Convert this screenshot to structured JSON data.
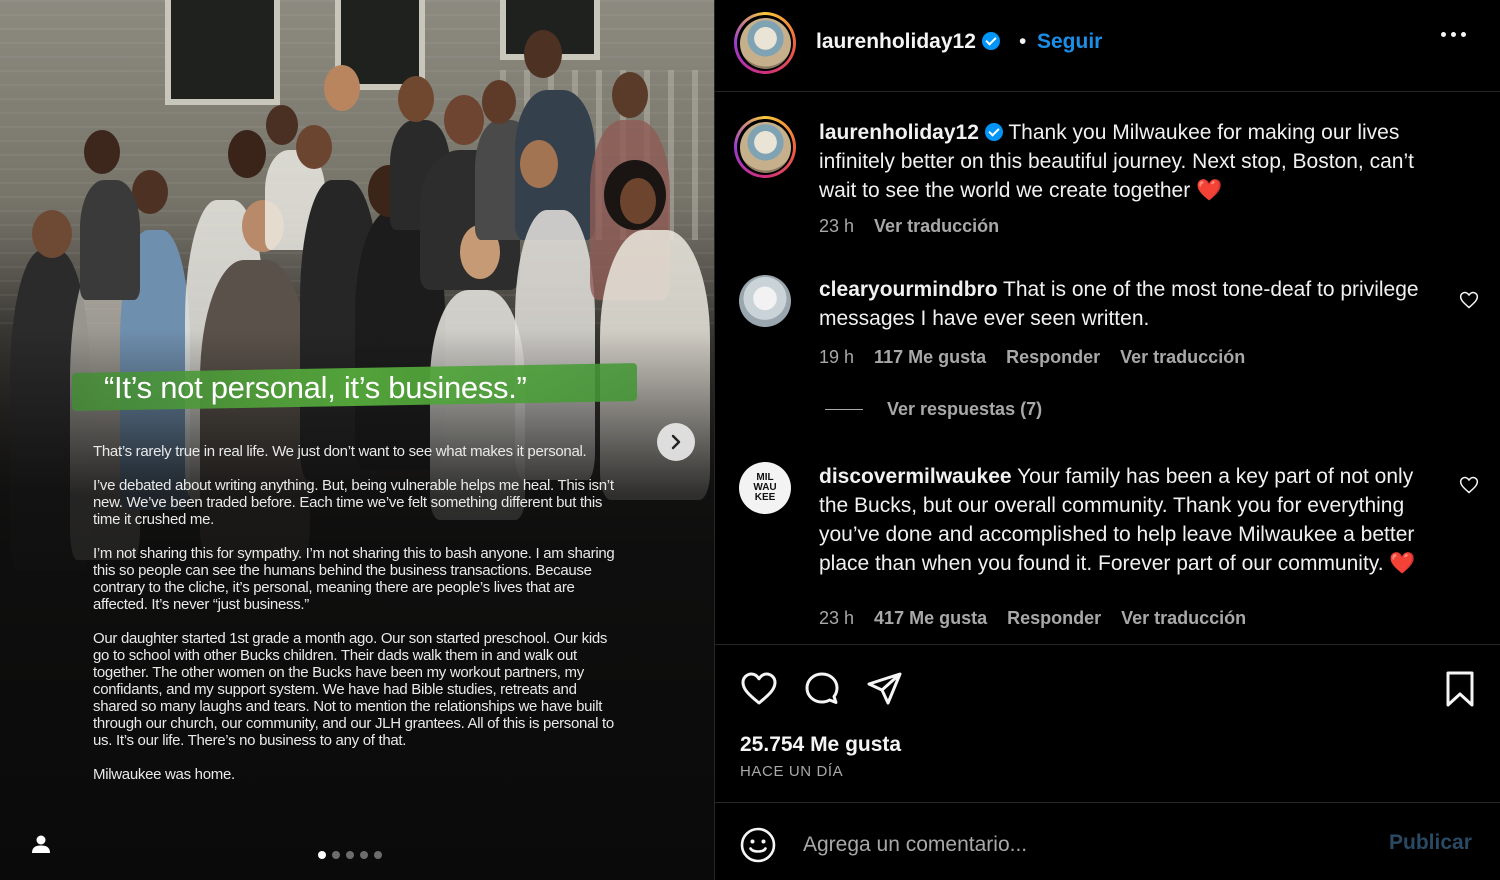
{
  "media": {
    "quote": "“It’s not personal, it’s business.”",
    "paragraphs": [
      "That’s rarely true in real life. We just don’t want to see what makes it personal.",
      "I’ve debated about writing anything. But, being vulnerable helps me heal. This isn’t new. We’ve  been traded before. Each time we’ve felt something different but this time it crushed me.",
      "I’m not sharing this for sympathy. I’m not sharing this to bash anyone. I am sharing this so people can see the humans behind the business transactions. Because contrary to the cliche, it’s personal, meaning there are people’s lives that are affected. It’s never “just business.”",
      "Our daughter started 1st grade a month ago. Our son started preschool. Our kids go to school with other Bucks children. Their dads walk them in and walk out together. The other women on the Bucks have been my workout partners, my confidants, and my support system. We have had Bible studies, retreats and shared so many laughs and tears. Not to mention the relationships we have built through our church, our community, and our JLH grantees. All of this is personal to us. It’s our life. There’s no business to any of that.",
      "Milwaukee was home."
    ],
    "carousel_total": 5,
    "carousel_active": 1,
    "icons": {
      "next": "chevron-right-icon",
      "tag": "user-icon"
    }
  },
  "header": {
    "username": "laurenholiday12",
    "separator": "•",
    "follow_label": "Seguir",
    "more_icon": "more-horizontal-icon"
  },
  "caption": {
    "username": "laurenholiday12",
    "text": "Thank you Milwaukee for making our lives infinitely better on this beautiful journey. Next stop, Boston, can’t wait to see the world we create together",
    "emoji": "❤️",
    "time": "23 h",
    "translate_label": "Ver traducción"
  },
  "comments": [
    {
      "username": "clearyourmindbro",
      "text": "That is one of the most tone-deaf to privilege messages I have ever seen written.",
      "time": "19 h",
      "likes": "117 Me gusta",
      "reply_label": "Responder",
      "translate_label": "Ver traducción",
      "view_replies": "Ver respuestas (7)"
    },
    {
      "username": "discovermilwaukee",
      "text": "Your family has been a key part of not only the Bucks, but our overall community. Thank you for everything you’ve done and accomplished to help leave Milwaukee a better place than when you found it. Forever part of our community.",
      "emoji": "❤️",
      "time": "23 h",
      "likes": "417 Me gusta",
      "reply_label": "Responder",
      "translate_label": "Ver traducción",
      "avatar_text": "MIL WAU KEE"
    }
  ],
  "actions": {
    "likes": "25.754 Me gusta",
    "date": "HACE UN DÍA",
    "icons": [
      "heart-icon",
      "comment-icon",
      "share-icon",
      "bookmark-icon"
    ]
  },
  "comment_bar": {
    "placeholder": "Agrega un comentario...",
    "publish_label": "Publicar"
  },
  "colors": {
    "background": "#000000",
    "accent_blue": "#1b8ee8",
    "verified_blue": "#0095f6",
    "muted_text": "#a8a8a8",
    "marker_green": "#56aa3c",
    "heart_red": "#e0245e"
  }
}
